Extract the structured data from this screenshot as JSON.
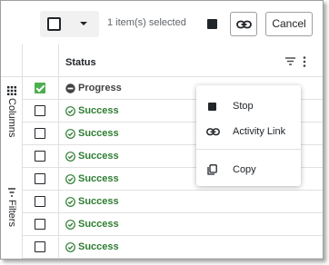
{
  "toolbar": {
    "selected_text": "1 item(s) selected",
    "cancel_label": "Cancel"
  },
  "side_panel": {
    "columns_label": "Columns",
    "filters_label": "Filters"
  },
  "grid": {
    "column_header": "Status",
    "rows": [
      {
        "status": "Progress",
        "checked": true
      },
      {
        "status": "Success",
        "checked": false
      },
      {
        "status": "Success",
        "checked": false
      },
      {
        "status": "Success",
        "checked": false
      },
      {
        "status": "Success",
        "checked": false
      },
      {
        "status": "Success",
        "checked": false
      },
      {
        "status": "Success",
        "checked": false
      },
      {
        "status": "Success",
        "checked": false
      }
    ]
  },
  "context_menu": {
    "items": [
      {
        "label": "Stop",
        "icon": "stop-icon"
      },
      {
        "label": "Activity Link",
        "icon": "link-icon"
      },
      {
        "label": "Copy",
        "icon": "copy-icon"
      }
    ]
  },
  "colors": {
    "success": "#2e7d32",
    "progress": "#424242",
    "checkbox_checked": "#4caf50"
  }
}
